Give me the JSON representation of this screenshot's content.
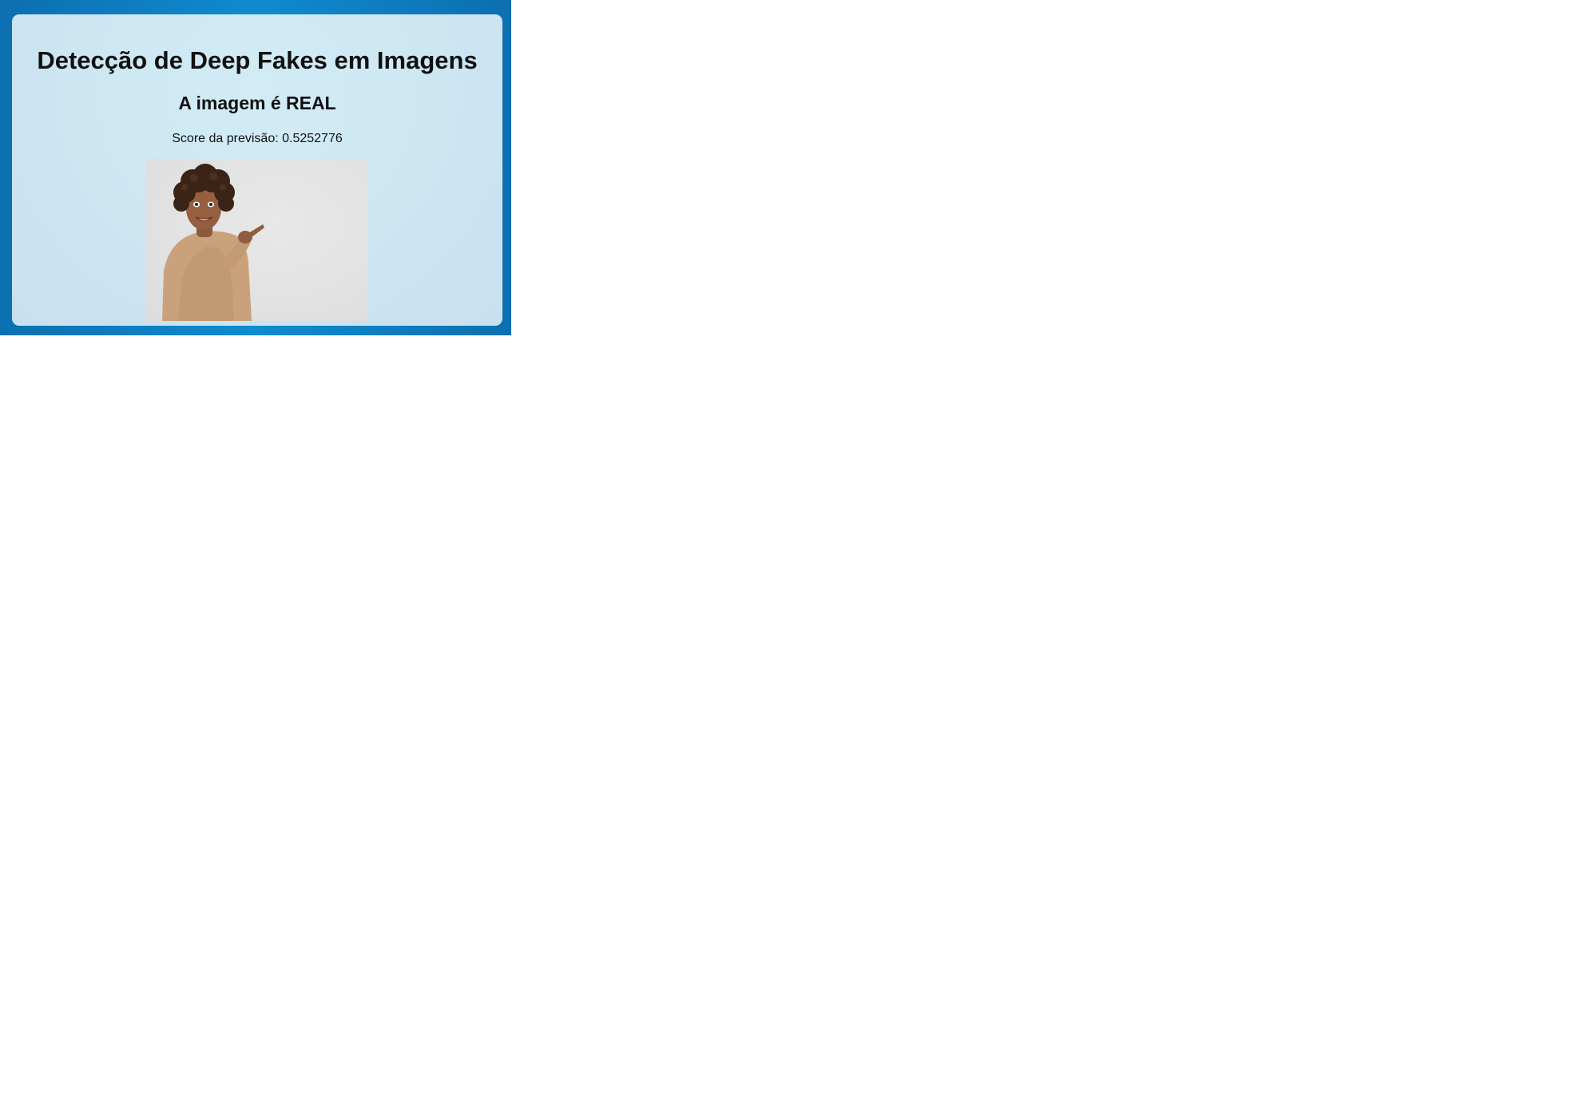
{
  "page": {
    "title": "Detecção de Deep Fakes em Imagens",
    "result": "A imagem é REAL",
    "score_label": "Score da previsão: 0.5252776"
  },
  "image": {
    "alt": "Mulher sorridente apontando para o lado",
    "kind": "photo-of-smiling-woman-pointing"
  },
  "colors": {
    "frame": "#0f8bd0",
    "card": "#cfe8f4",
    "text": "#111111",
    "photo_bg": "#e2e2e2"
  }
}
